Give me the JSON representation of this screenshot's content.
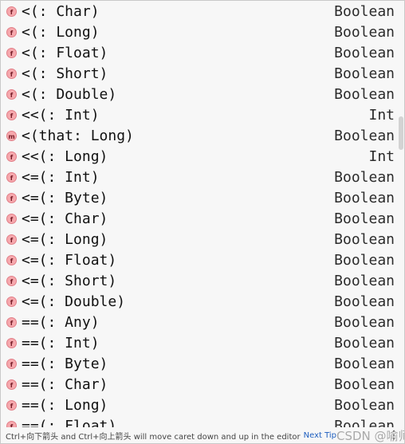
{
  "completion_items": [
    {
      "icon": "f",
      "name": "<(: Char)",
      "type": "Boolean"
    },
    {
      "icon": "f",
      "name": "<(: Long)",
      "type": "Boolean"
    },
    {
      "icon": "f",
      "name": "<(: Float)",
      "type": "Boolean"
    },
    {
      "icon": "f",
      "name": "<(: Short)",
      "type": "Boolean"
    },
    {
      "icon": "f",
      "name": "<(: Double)",
      "type": "Boolean"
    },
    {
      "icon": "f",
      "name": "<<(: Int)",
      "type": "Int"
    },
    {
      "icon": "m",
      "name": "<(that: Long)",
      "type": "Boolean"
    },
    {
      "icon": "f",
      "name": "<<(: Long)",
      "type": "Int"
    },
    {
      "icon": "f",
      "name": "<=(: Int)",
      "type": "Boolean"
    },
    {
      "icon": "f",
      "name": "<=(: Byte)",
      "type": "Boolean"
    },
    {
      "icon": "f",
      "name": "<=(: Char)",
      "type": "Boolean"
    },
    {
      "icon": "f",
      "name": "<=(: Long)",
      "type": "Boolean"
    },
    {
      "icon": "f",
      "name": "<=(: Float)",
      "type": "Boolean"
    },
    {
      "icon": "f",
      "name": "<=(: Short)",
      "type": "Boolean"
    },
    {
      "icon": "f",
      "name": "<=(: Double)",
      "type": "Boolean"
    },
    {
      "icon": "f",
      "name": "==(: Any)",
      "type": "Boolean"
    },
    {
      "icon": "f",
      "name": "==(: Int)",
      "type": "Boolean"
    },
    {
      "icon": "f",
      "name": "==(: Byte)",
      "type": "Boolean"
    },
    {
      "icon": "f",
      "name": "==(: Char)",
      "type": "Boolean"
    },
    {
      "icon": "f",
      "name": "==(: Long)",
      "type": "Boolean"
    },
    {
      "icon": "f",
      "name": "==(: Float)",
      "type": "Boolean"
    }
  ],
  "footer": {
    "hint": "Ctrl+向下箭头 and Ctrl+向上箭头 will move caret down and up in the editor",
    "next_tip": "Next Tip",
    "watermark": "CSDN @喻师傅",
    "more_icon": "⋮"
  },
  "colors": {
    "icon_fill": "#f6a8ad",
    "icon_border": "#e27f88",
    "background": "#f7f7f7",
    "link": "#1f5fbf"
  }
}
